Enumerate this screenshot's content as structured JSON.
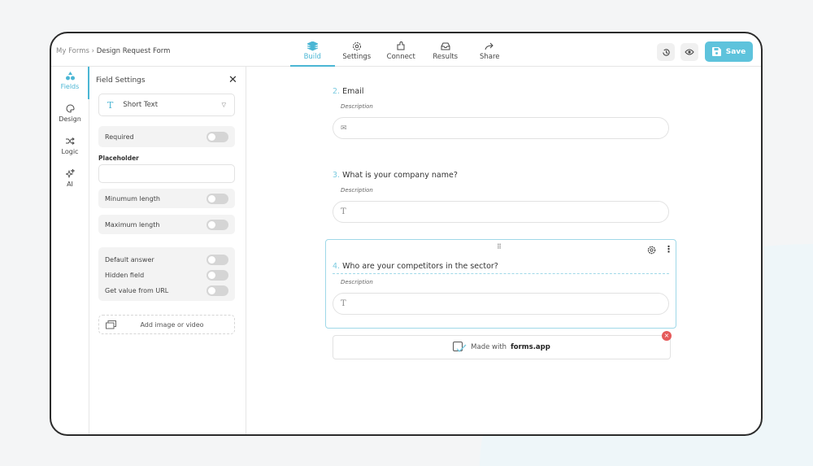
{
  "breadcrumb": {
    "root": "My Forms",
    "sep": "›",
    "current": "Design Request Form"
  },
  "tabs": [
    {
      "label": "Build",
      "icon": "layers-icon"
    },
    {
      "label": "Settings",
      "icon": "gear-icon"
    },
    {
      "label": "Connect",
      "icon": "puzzle-icon"
    },
    {
      "label": "Results",
      "icon": "inbox-icon"
    },
    {
      "label": "Share",
      "icon": "share-icon"
    }
  ],
  "header": {
    "save_label": "Save"
  },
  "rail": [
    {
      "label": "Fields"
    },
    {
      "label": "Design"
    },
    {
      "label": "Logic"
    },
    {
      "label": "AI"
    }
  ],
  "panel": {
    "title": "Field Settings",
    "close": "✕",
    "field_type": "Short Text",
    "field_type_icon": "T",
    "required": "Required",
    "placeholder_label": "Placeholder",
    "placeholder_value": "",
    "min_length": "Minumum length",
    "max_length": "Maximum length",
    "default_answer": "Default answer",
    "hidden_field": "Hidden field",
    "get_value_url": "Get value from URL",
    "add_media": "Add image or video"
  },
  "questions": [
    {
      "num": "2.",
      "title": "Email",
      "desc": "Description",
      "icon": "✉"
    },
    {
      "num": "3.",
      "title": "What is your company name?",
      "desc": "Description",
      "icon": "T"
    },
    {
      "num": "4.",
      "title": "Who are your competitors in the sector?",
      "desc": "Description",
      "icon": "T"
    }
  ],
  "branding": {
    "prefix": "Made with",
    "brand": "forms.app",
    "close": "×"
  },
  "colors": {
    "accent": "#4bb6d4",
    "save": "#5ec3dc",
    "danger": "#e55a5a"
  }
}
